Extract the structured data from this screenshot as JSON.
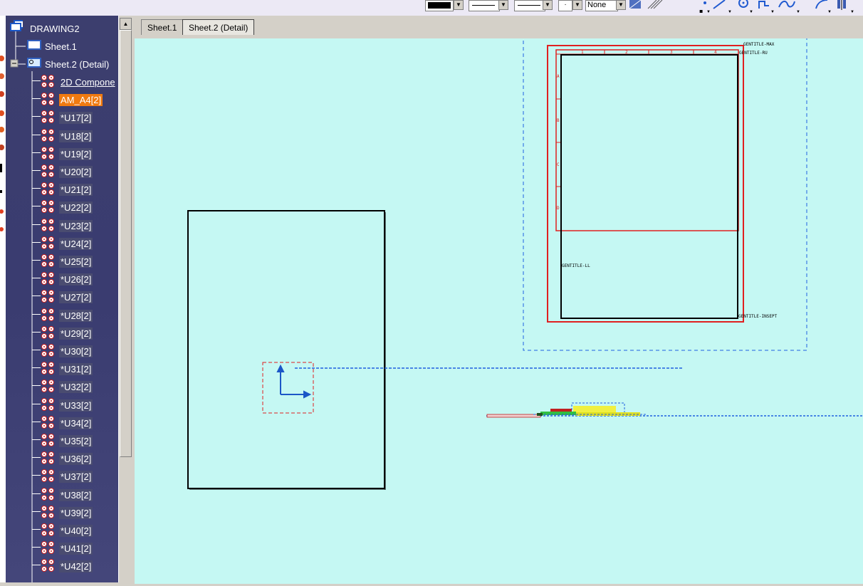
{
  "toolbar": {
    "fill_pattern_value": "None"
  },
  "tree": {
    "root_label": "DRAWING2",
    "sheet1_label": "Sheet.1",
    "sheet2_label": "Sheet.2 (Detail)",
    "components_label": "2D Compone",
    "selected_item": "AM_A4[2]",
    "items": [
      "*U17[2]",
      "*U18[2]",
      "*U19[2]",
      "*U20[2]",
      "*U21[2]",
      "*U22[2]",
      "*U23[2]",
      "*U24[2]",
      "*U25[2]",
      "*U26[2]",
      "*U27[2]",
      "*U28[2]",
      "*U29[2]",
      "*U30[2]",
      "*U31[2]",
      "*U32[2]",
      "*U33[2]",
      "*U34[2]",
      "*U35[2]",
      "*U36[2]",
      "*U37[2]",
      "*U38[2]",
      "*U39[2]",
      "*U40[2]",
      "*U41[2]",
      "*U42[2]"
    ]
  },
  "tabs": [
    {
      "label": "Sheet.1",
      "active": false
    },
    {
      "label": "Sheet.2 (Detail)",
      "active": true
    }
  ],
  "canvas": {
    "frame_labels": {
      "max": "GENTITLE-MAX",
      "ru": "GENTITLE-RU",
      "ll": "GENTITLE-LL",
      "insept": "GENTITLE-INSEPT"
    },
    "column_numbers": [
      "1",
      "2",
      "3",
      "4"
    ],
    "row_letters": [
      "A",
      "B",
      "C",
      "D"
    ]
  },
  "colors": {
    "canvas_bg": "#c5f8f3",
    "tree_bg": "#3c3e6e",
    "selection": "#f07a10",
    "frame_red": "#e02020",
    "dash_blue": "#2060e0"
  }
}
